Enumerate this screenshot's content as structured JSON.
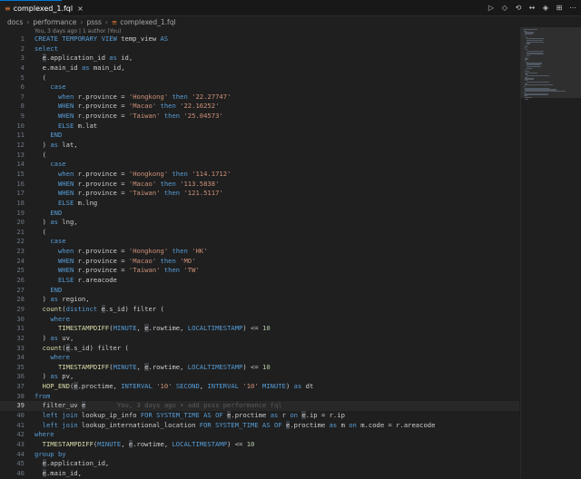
{
  "tab": {
    "title": "complexed_1.fql",
    "close_label": "×",
    "icon": "file-icon"
  },
  "toolbar": [
    "▷",
    "◇",
    "⟲",
    "↔",
    "◈",
    "⊞",
    "⋯"
  ],
  "breadcrumb": {
    "items": [
      "docs",
      "performance",
      "psss"
    ],
    "file": "complexed_1.fql",
    "separator": "›"
  },
  "blame_header": "You, 3 days ago | 1 author (You)",
  "active_line": 39,
  "inline_blame": "You, 3 days ago • add psss performance fql",
  "code_lines": [
    {
      "n": 1,
      "html": "<span class=\"k\">CREATE TEMPORARY VIEW</span> temp_view <span class=\"k\">AS</span>"
    },
    {
      "n": 2,
      "html": "<span class=\"k\">select</span>"
    },
    {
      "n": 3,
      "html": "  <span class=\"h\">e</span>.application_id <span class=\"k\">as</span> id,"
    },
    {
      "n": 4,
      "html": "  e.main_id <span class=\"k\">as</span> main_id,"
    },
    {
      "n": 5,
      "html": "  ("
    },
    {
      "n": 6,
      "html": "    <span class=\"k\">case</span>"
    },
    {
      "n": 7,
      "html": "      <span class=\"k\">when</span> r.province = <span class=\"s\">'Hongkong'</span> <span class=\"k\">then</span> <span class=\"s\">'22.27747'</span>"
    },
    {
      "n": 8,
      "html": "      <span class=\"k\">WHEN</span> r.province = <span class=\"s\">'Macao'</span> <span class=\"k\">then</span> <span class=\"s\">'22.16252'</span>"
    },
    {
      "n": 9,
      "html": "      <span class=\"k\">WHEN</span> r.province = <span class=\"s\">'Taiwan'</span> <span class=\"k\">then</span> <span class=\"s\">'25.04573'</span>"
    },
    {
      "n": 10,
      "html": "      <span class=\"k\">ELSE</span> m.lat"
    },
    {
      "n": 11,
      "html": "    <span class=\"k\">END</span>"
    },
    {
      "n": 12,
      "html": "  ) <span class=\"k\">as</span> lat,"
    },
    {
      "n": 13,
      "html": "  ("
    },
    {
      "n": 14,
      "html": "    <span class=\"k\">case</span>"
    },
    {
      "n": 15,
      "html": "      <span class=\"k\">when</span> r.province = <span class=\"s\">'Hongkong'</span> <span class=\"k\">then</span> <span class=\"s\">'114.1712'</span>"
    },
    {
      "n": 16,
      "html": "      <span class=\"k\">WHEN</span> r.province = <span class=\"s\">'Macao'</span> <span class=\"k\">then</span> <span class=\"s\">'113.5838'</span>"
    },
    {
      "n": 17,
      "html": "      <span class=\"k\">WHEN</span> r.province = <span class=\"s\">'Taiwan'</span> <span class=\"k\">then</span> <span class=\"s\">'121.5117'</span>"
    },
    {
      "n": 18,
      "html": "      <span class=\"k\">ELSE</span> m.lng"
    },
    {
      "n": 19,
      "html": "    <span class=\"k\">END</span>"
    },
    {
      "n": 20,
      "html": "  ) <span class=\"k\">as</span> lng,"
    },
    {
      "n": 21,
      "html": "  ("
    },
    {
      "n": 22,
      "html": "    <span class=\"k\">case</span>"
    },
    {
      "n": 23,
      "html": "      <span class=\"k\">when</span> r.province = <span class=\"s\">'Hongkong'</span> <span class=\"k\">then</span> <span class=\"s\">'HK'</span>"
    },
    {
      "n": 24,
      "html": "      <span class=\"k\">WHEN</span> r.province = <span class=\"s\">'Macao'</span> <span class=\"k\">then</span> <span class=\"s\">'MO'</span>"
    },
    {
      "n": 25,
      "html": "      <span class=\"k\">WHEN</span> r.province = <span class=\"s\">'Taiwan'</span> <span class=\"k\">then</span> <span class=\"s\">'TW'</span>"
    },
    {
      "n": 26,
      "html": "      <span class=\"k\">ELSE</span> r.areacode"
    },
    {
      "n": 27,
      "html": "    <span class=\"k\">END</span>"
    },
    {
      "n": 28,
      "html": "  ) <span class=\"k\">as</span> region,"
    },
    {
      "n": 29,
      "html": "  <span class=\"f\">count</span>(<span class=\"k\">distinct</span> <span class=\"h\">e</span>.s_id) filter ("
    },
    {
      "n": 30,
      "html": "    <span class=\"k\">where</span>"
    },
    {
      "n": 31,
      "html": "      <span class=\"f\">TIMESTAMPDIFF</span>(<span class=\"k\">MINUTE</span>, <span class=\"h\">e</span>.rowtime, <span class=\"k\">LOCALTIMESTAMP</span>) &lt;= <span class=\"n\">10</span>"
    },
    {
      "n": 32,
      "html": "  ) <span class=\"k\">as</span> uv,"
    },
    {
      "n": 33,
      "html": "  <span class=\"f\">count</span>(<span class=\"h\">e</span>.s_id) filter ("
    },
    {
      "n": 34,
      "html": "    <span class=\"k\">where</span>"
    },
    {
      "n": 35,
      "html": "      <span class=\"f\">TIMESTAMPDIFF</span>(<span class=\"k\">MINUTE</span>, <span class=\"h\">e</span>.rowtime, <span class=\"k\">LOCALTIMESTAMP</span>) &lt;= <span class=\"n\">10</span>"
    },
    {
      "n": 36,
      "html": "  ) <span class=\"k\">as</span> pv,"
    },
    {
      "n": 37,
      "html": "  <span class=\"f\">HOP_END</span>(<span class=\"h\">e</span>.proctime, <span class=\"k\">INTERVAL</span> <span class=\"s\">'10'</span> <span class=\"k\">SECOND</span>, <span class=\"k\">INTERVAL</span> <span class=\"s\">'10'</span> <span class=\"k\">MINUTE</span>) <span class=\"k\">as</span> dt"
    },
    {
      "n": 38,
      "html": "<span class=\"k\">from</span>"
    },
    {
      "n": 39,
      "html": "  filter_uv <span class=\"h\">e</span>        <span class=\"blame-inline\">You, 3 days ago • add psss performance fql</span>"
    },
    {
      "n": 40,
      "html": "  <span class=\"k\">left join</span> lookup_ip_info <span class=\"k\">FOR</span> <span class=\"k\">SYSTEM_TIME</span> <span class=\"k\">AS OF</span> <span class=\"h\">e</span>.proctime <span class=\"k\">as</span> r <span class=\"k\">on</span> <span class=\"h\">e</span>.ip = r.ip"
    },
    {
      "n": 41,
      "html": "  <span class=\"k\">left join</span> lookup_international_location <span class=\"k\">FOR</span> <span class=\"k\">SYSTEM_TIME</span> <span class=\"k\">AS OF</span> <span class=\"h\">e</span>.proctime <span class=\"k\">as</span> m <span class=\"k\">on</span> m.code = r.areacode"
    },
    {
      "n": 42,
      "html": "<span class=\"k\">where</span>"
    },
    {
      "n": 43,
      "html": "  <span class=\"f\">TIMESTAMPDIFF</span>(<span class=\"k\">MINUTE</span>, <span class=\"h\">e</span>.rowtime, <span class=\"k\">LOCALTIMESTAMP</span>) &lt;= <span class=\"n\">10</span>"
    },
    {
      "n": 44,
      "html": "<span class=\"k\">group by</span>"
    },
    {
      "n": 45,
      "html": "  <span class=\"h\">e</span>.application_id,"
    },
    {
      "n": 46,
      "html": "  <span class=\"h\">e</span>.main_id,"
    }
  ]
}
